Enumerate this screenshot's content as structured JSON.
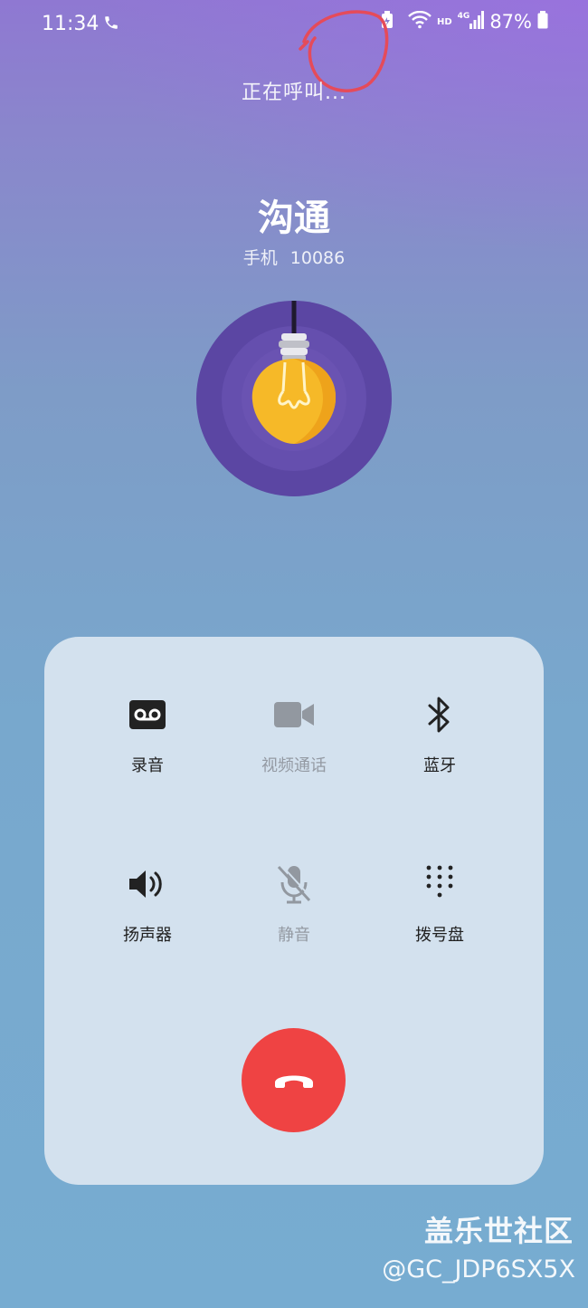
{
  "status_bar": {
    "time": "11:34",
    "battery": "87%",
    "network_hd": "HD",
    "network_gen": "4G",
    "icons": [
      "phone-call-icon",
      "battery-saver-icon",
      "wifi-icon",
      "signal-icon",
      "battery-icon"
    ]
  },
  "call": {
    "status": "正在呼叫...",
    "contact_name": "沟通",
    "number_type": "手机",
    "number": "10086"
  },
  "controls": [
    {
      "label": "录音",
      "icon": "voicemail-record-icon",
      "enabled": true
    },
    {
      "label": "视频通话",
      "icon": "video-camera-icon",
      "enabled": false
    },
    {
      "label": "蓝牙",
      "icon": "bluetooth-icon",
      "enabled": true
    },
    {
      "label": "扬声器",
      "icon": "speaker-icon",
      "enabled": true
    },
    {
      "label": "静音",
      "icon": "mic-off-icon",
      "enabled": false
    },
    {
      "label": "拨号盘",
      "icon": "dialpad-icon",
      "enabled": true
    }
  ],
  "end_call": {
    "icon": "hang-up-icon",
    "color": "#ef4343"
  },
  "watermark": {
    "line1": "盖乐世社区",
    "line2": "@GC_JDP6SX5X"
  },
  "colors": {
    "panel": "#d3e1ee",
    "end_call": "#ef4343",
    "avatar_bg": "#5a46a0",
    "bulb": "#f6b928"
  }
}
